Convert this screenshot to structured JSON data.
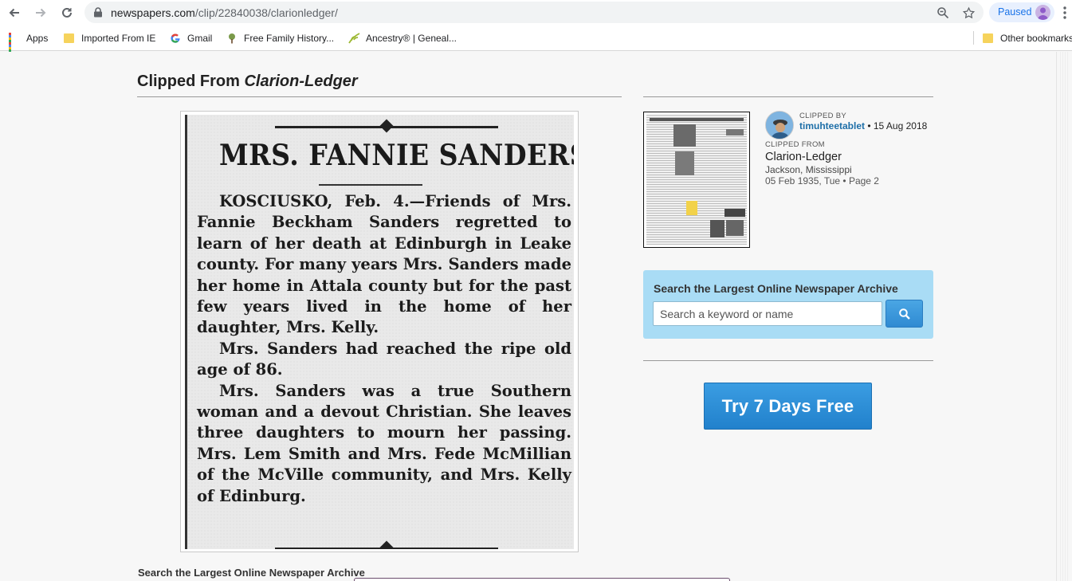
{
  "browser": {
    "url_host": "newspapers.com",
    "url_path": "/clip/22840038/clarionledger/",
    "profile_status": "Paused"
  },
  "bookmarks": [
    {
      "label": "Apps",
      "icon": "apps-grid-icon"
    },
    {
      "label": "Imported From IE",
      "icon": "folder-icon"
    },
    {
      "label": "Gmail",
      "icon": "google-icon"
    },
    {
      "label": "Free Family History...",
      "icon": "tree-icon"
    },
    {
      "label": "Ancestry® | Geneal...",
      "icon": "leaf-icon"
    },
    {
      "label": "Other bookmarks",
      "icon": "folder-icon"
    }
  ],
  "clip": {
    "title_prefix": "Clipped From ",
    "title_paper": "Clarion-Ledger",
    "headline": "MRS. FANNIE SANDERS",
    "paragraphs": [
      "KOSCIUSKO, Feb. 4.—Friends of Mrs. Fannie Beckham Sanders regretted to learn of her death at Edinburgh in Leake county. For many years Mrs. Sanders made her home in Attala county but for the past few years lived in the home of her daughter, Mrs. Kelly.",
      "Mrs. Sanders had reached the ripe old age of 86.",
      "Mrs. Sanders was a true Southern woman and a devout Christian. She leaves three daughters to mourn her passing. Mrs. Lem Smith and Mrs. Fede McMillian of the McVille community, and Mrs. Kelly of Edinburg."
    ]
  },
  "meta": {
    "clipped_by_label": "CLIPPED BY",
    "username": "timuhteetablet",
    "clip_date": " • 15 Aug 2018",
    "clipped_from_label": "CLIPPED FROM",
    "paper": "Clarion-Ledger",
    "location": "Jackson, Mississippi",
    "date_page": "05 Feb 1935, Tue  •  Page 2"
  },
  "search": {
    "heading": "Search the Largest Online Newspaper Archive",
    "placeholder": "Search a keyword or name"
  },
  "cta": {
    "label": "Try 7 Days Free"
  },
  "bottom": {
    "heading": "Search the Largest Online Newspaper Archive"
  },
  "colors": {
    "link": "#1e6fa8",
    "search_bg": "#a9dcf5",
    "cta": "#2a8bd6"
  }
}
